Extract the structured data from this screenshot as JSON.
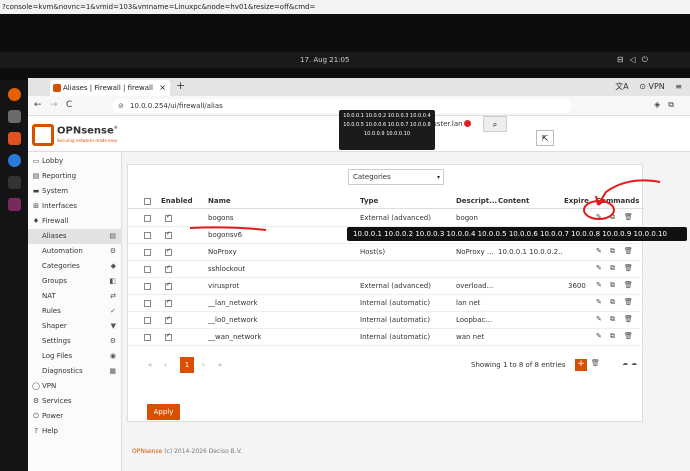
{
  "outer": {
    "url_fragment": "?console=kvm&novnc=1&vmid=103&vmname=Linuxpc&node=hv01&resize=off&cmd="
  },
  "desktop": {
    "clock": "17. Aug 21:05",
    "tray_icons": [
      "network-icon",
      "volume-icon",
      "power-icon"
    ]
  },
  "browser": {
    "tab_title": "Aliases | Firewall | firewall",
    "tab_close": "×",
    "new_tab": "+",
    "vpn_label": "VPN",
    "url": "10.0.0.254/ui/firewall/alias",
    "nav": {
      "back": "←",
      "forward": "→",
      "reload": "C"
    }
  },
  "header": {
    "logo_text": "OPNsense",
    "logo_reg": "®",
    "logo_tagline": "Securing networks made easy",
    "user": "root@firewall.linuxmuster.lan",
    "search_icon": "⌕"
  },
  "sidebar": {
    "items": [
      {
        "icon": "▭",
        "label": "Lobby"
      },
      {
        "icon": "▤",
        "label": "Reporting"
      },
      {
        "icon": "▬",
        "label": "System"
      },
      {
        "icon": "⊞",
        "label": "Interfaces"
      },
      {
        "icon": "♦",
        "label": "Firewall"
      }
    ],
    "firewall_sub": [
      {
        "label": "Aliases",
        "ricon": "▤"
      },
      {
        "label": "Automation",
        "ricon": "⚙"
      },
      {
        "label": "Categories",
        "ricon": "◆"
      },
      {
        "label": "Groups",
        "ricon": "◧"
      },
      {
        "label": "NAT",
        "ricon": "⇄"
      },
      {
        "label": "Rules",
        "ricon": "✓"
      },
      {
        "label": "Shaper",
        "ricon": "▼"
      },
      {
        "label": "Settings",
        "ricon": "⚙"
      },
      {
        "label": "Log Files",
        "ricon": "◉"
      },
      {
        "label": "Diagnostics",
        "ricon": "▦"
      }
    ],
    "bottom": [
      {
        "icon": "◯",
        "label": "VPN"
      },
      {
        "icon": "⚙",
        "label": "Services"
      },
      {
        "icon": "⏻",
        "label": "Power"
      },
      {
        "icon": "?",
        "label": "Help"
      }
    ]
  },
  "toolbar": {
    "categories_placeholder": "Categories",
    "caret": "▾",
    "export_icon": "⇱"
  },
  "table": {
    "headers": {
      "enabled": "Enabled",
      "name": "Name",
      "type": "Type",
      "description": "Descript...",
      "content": "Content",
      "expire": "Expire",
      "commands": "Commands"
    },
    "rows": [
      {
        "name": "bogons",
        "type": "External (advanced)",
        "description": "bogon",
        "content": "",
        "expire": ""
      },
      {
        "name": "bogonsv6",
        "type": "External (advanced)",
        "description": "bogon",
        "content": "",
        "expire": ""
      },
      {
        "name": "NoProxy",
        "type": "Host(s)",
        "description": "NoProxy ...",
        "content": "10.0.0.1 10.0.0.2...",
        "expire": ""
      },
      {
        "name": "sshlockout",
        "type": "",
        "description": "",
        "content": "",
        "expire": ""
      },
      {
        "name": "virusprot",
        "type": "External (advanced)",
        "description": "overload...",
        "content": "",
        "expire": "3600"
      },
      {
        "name": "__lan_network",
        "type": "Internal (automatic)",
        "description": "lan net",
        "content": "",
        "expire": ""
      },
      {
        "name": "__lo0_network",
        "type": "Internal (automatic)",
        "description": "Loopbac...",
        "content": "",
        "expire": ""
      },
      {
        "name": "__wan_network",
        "type": "Internal (automatic)",
        "description": "wan net",
        "content": "",
        "expire": ""
      }
    ],
    "command_icons": {
      "edit": "✎",
      "copy": "⧉",
      "delete": "🗑"
    }
  },
  "tooltip_small": {
    "line1": "10.0.0.1 10.0.0.2 10.0.0.3 10.0.0.4",
    "line2": "10.0.0.5 10.0.0.6 10.0.0.7 10.0.0.8",
    "line3": "10.0.0.9 10.0.0.10"
  },
  "tooltip_bar": "10.0.0.1 10.0.0.2 10.0.0.3 10.0.0.4 10.0.0.5 10.0.0.6 10.0.0.7 10.0.0.8 10.0.0.9 10.0.0.10",
  "pager": {
    "first": "«",
    "prev": "‹",
    "current": "1",
    "next": "›",
    "last": "»",
    "showing": "Showing 1 to 8 of 8 entries",
    "add": "+",
    "delete_icon": "🗑",
    "download_icons": "☁☁"
  },
  "apply_label": "Apply",
  "footer": {
    "brand": "OPNsense",
    "rest": " (c) 2014-2026 Deciso B.V."
  },
  "colors": {
    "accent": "#d94f00",
    "annotation": "#e51b1b",
    "tooltip_bg": "#111111"
  }
}
